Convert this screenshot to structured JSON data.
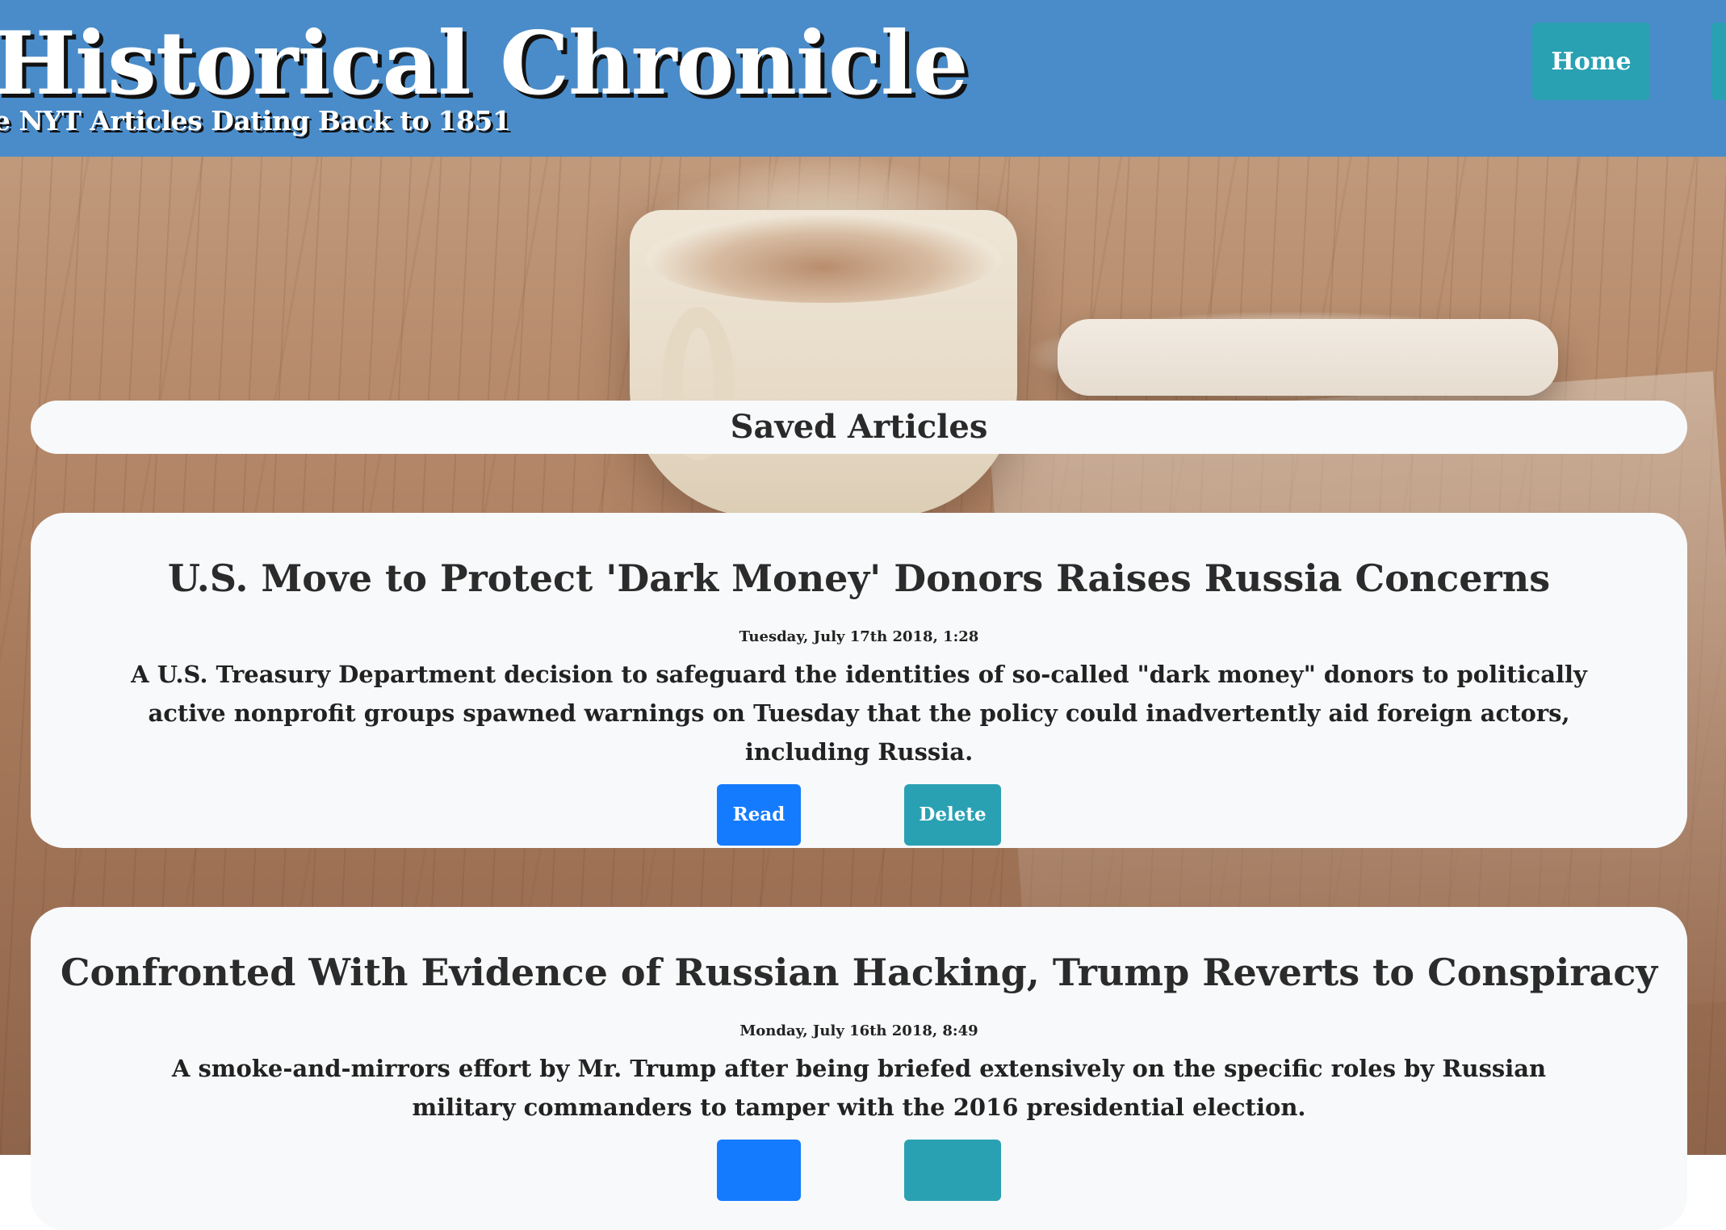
{
  "header": {
    "title": "Historical Chronicle",
    "subtitle": "e NYT Articles Dating Back to 1851",
    "nav": {
      "home_label": "Home",
      "saved_label": ""
    }
  },
  "main": {
    "section_title": "Saved Articles",
    "articles": [
      {
        "title": "U.S. Move to Protect 'Dark Money' Donors Raises Russia Concerns",
        "date": "Tuesday, July 17th 2018, 1:28",
        "summary": "A U.S. Treasury Department decision to safeguard the identities of so-called \"dark money\" donors to politically active nonprofit groups spawned warnings on Tuesday that the policy could inadvertently aid foreign actors, including Russia.",
        "read_label": "Read",
        "delete_label": "Delete"
      },
      {
        "title": "Confronted With Evidence of Russian Hacking, Trump Reverts to Conspiracy",
        "date": "Monday, July 16th 2018, 8:49",
        "summary": "A smoke-and-mirrors effort by Mr. Trump after being briefed extensively on the specific roles by Russian military commanders to tamper with the 2016 presidential election.",
        "read_label": "",
        "delete_label": ""
      }
    ]
  },
  "colors": {
    "header_bg": "#4a8cc9",
    "nav_button": "#2aa1b3",
    "read_button": "#147bff",
    "delete_button": "#2aa1b3",
    "card_bg": "#f8f9fa"
  },
  "background_image": "coffee-cup-phone-on-wooden-table"
}
